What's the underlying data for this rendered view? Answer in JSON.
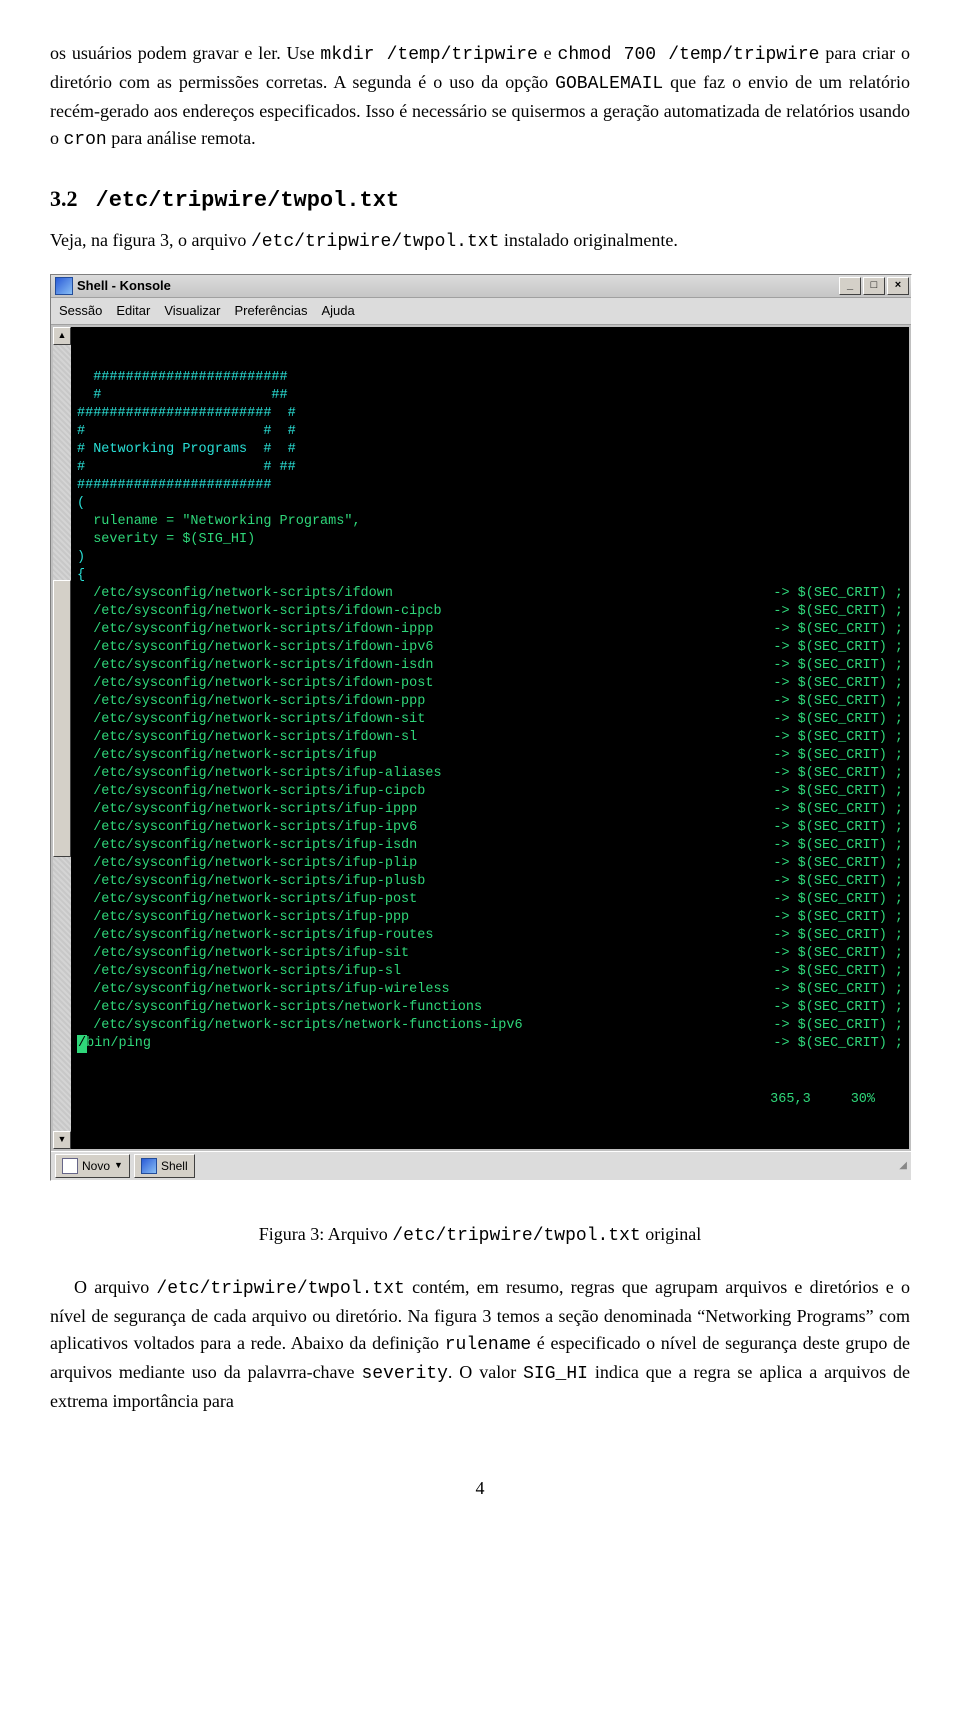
{
  "intro": {
    "p1a": "os usuários podem gravar e ler.  Use ",
    "cmd1": "mkdir /temp/tripwire",
    "p1b": " e ",
    "cmd2": "chmod 700 /temp/tripwire",
    "p1c": " para criar o diretório com as permissões corretas. A segunda é o uso da opção ",
    "opt": "GOBALEMAIL",
    "p1d": " que faz o envio de um relatório recém-gerado aos endereços especificados. Isso é necessário se quisermos a geração automatizada de relatórios usando o ",
    "cron": "cron",
    "p1e": " para análise remota."
  },
  "section": {
    "num": "3.2",
    "title": "/etc/tripwire/twpol.txt",
    "p2a": "Veja, na figura 3, o arquivo ",
    "file": "/etc/tripwire/twpol.txt",
    "p2b": " instalado originalmente."
  },
  "konsole": {
    "title": "Shell - Konsole",
    "menu": [
      "Sessão",
      "Editar",
      "Visualizar",
      "Preferências",
      "Ajuda"
    ],
    "winbtns": [
      "_",
      "□",
      "×"
    ],
    "scroll_up": "▲",
    "scroll_down": "▼",
    "header_lines": [
      "  ########################",
      "  #                     ##",
      "########################  #",
      "#                      #  #",
      "# Networking Programs  #  #",
      "#                      # ##",
      "########################",
      "",
      "("
    ],
    "rule_lines": [
      "  rulename = \"Networking Programs\",",
      "  severity = $(SIG_HI)"
    ],
    "brace_lines": [
      ")",
      "{"
    ],
    "entries": [
      "/etc/sysconfig/network-scripts/ifdown",
      "/etc/sysconfig/network-scripts/ifdown-cipcb",
      "/etc/sysconfig/network-scripts/ifdown-ippp",
      "/etc/sysconfig/network-scripts/ifdown-ipv6",
      "/etc/sysconfig/network-scripts/ifdown-isdn",
      "/etc/sysconfig/network-scripts/ifdown-post",
      "/etc/sysconfig/network-scripts/ifdown-ppp",
      "/etc/sysconfig/network-scripts/ifdown-sit",
      "/etc/sysconfig/network-scripts/ifdown-sl",
      "/etc/sysconfig/network-scripts/ifup",
      "/etc/sysconfig/network-scripts/ifup-aliases",
      "/etc/sysconfig/network-scripts/ifup-cipcb",
      "/etc/sysconfig/network-scripts/ifup-ippp",
      "/etc/sysconfig/network-scripts/ifup-ipv6",
      "/etc/sysconfig/network-scripts/ifup-isdn",
      "/etc/sysconfig/network-scripts/ifup-plip",
      "/etc/sysconfig/network-scripts/ifup-plusb",
      "/etc/sysconfig/network-scripts/ifup-post",
      "/etc/sysconfig/network-scripts/ifup-ppp",
      "/etc/sysconfig/network-scripts/ifup-routes",
      "/etc/sysconfig/network-scripts/ifup-sit",
      "/etc/sysconfig/network-scripts/ifup-sl",
      "/etc/sysconfig/network-scripts/ifup-wireless",
      "/etc/sysconfig/network-scripts/network-functions",
      "/etc/sysconfig/network-scripts/network-functions-ipv6"
    ],
    "entry_right": "-> $(SEC_CRIT) ;",
    "last_line": {
      "cursor": "/",
      "rest": "bin/ping",
      "right": "-> $(SEC_CRIT) ;"
    },
    "status": {
      "pos": "365,3",
      "pct": "30%"
    },
    "bottom": {
      "novo": "Novo",
      "shell": "Shell"
    }
  },
  "figure": {
    "label_a": "Figura 3: Arquivo ",
    "file": "/etc/tripwire/twpol.txt",
    "label_b": " original"
  },
  "body2": {
    "p3a": "O arquivo ",
    "file": "/etc/tripwire/twpol.txt",
    "p3b": " contém, em resumo, regras que agrupam arquivos e diretórios e o nível de segurança de cada arquivo ou diretório. Na figura 3 temos a seção denominada “Networking Programs” com aplicativos voltados para a rede. Abaixo da definição ",
    "rn": "rulename",
    "p3c": " é especificado o nível de segurança deste grupo de arquivos mediante uso da palavrra-chave ",
    "sev": "severity",
    "p3d": ". O valor ",
    "sig": "SIG_HI",
    "p3e": " indica que a regra se aplica a arquivos de extrema importância para"
  },
  "page": "4"
}
